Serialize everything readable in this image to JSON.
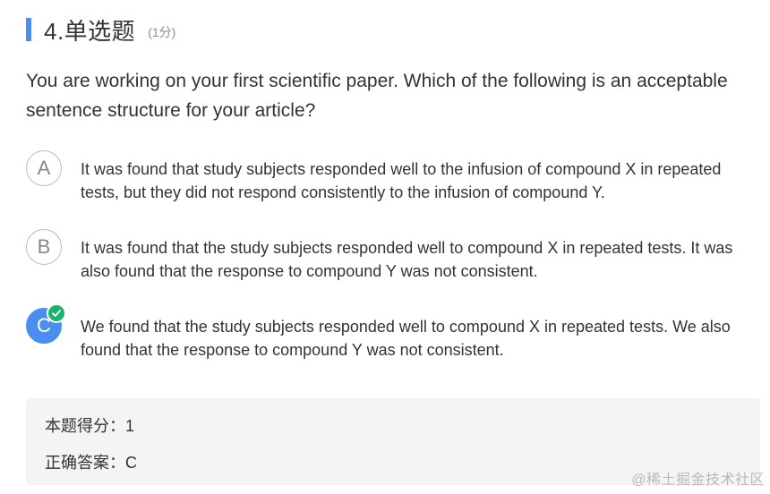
{
  "question": {
    "title": "4.单选题",
    "score_note": "(1分)",
    "text": "You are working on your first scientific paper. Which of the following is an acceptable sentence structure for your article?"
  },
  "options": [
    {
      "letter": "A",
      "text": "It was found that study subjects responded well to the infusion of compound X in repeated tests, but they did not respond consistently to the infusion of compound Y."
    },
    {
      "letter": "B",
      "text": "It was found that the study subjects responded well to compound X in repeated tests. It was also found that the response to compound Y was not consistent."
    },
    {
      "letter": "C",
      "text": "We found that the study subjects responded well to compound X in repeated tests. We also found that the response to compound Y was not consistent.",
      "selected_correct": true
    }
  ],
  "result": {
    "score_line": "本题得分：1",
    "answer_line": "正确答案：C"
  },
  "watermark": "@稀土掘金技术社区",
  "colors": {
    "accent": "#4a8ff0",
    "correct_badge": "#1db36f",
    "result_bg": "#f4f4f4"
  },
  "icons": {
    "correct_badge": "check-icon"
  }
}
